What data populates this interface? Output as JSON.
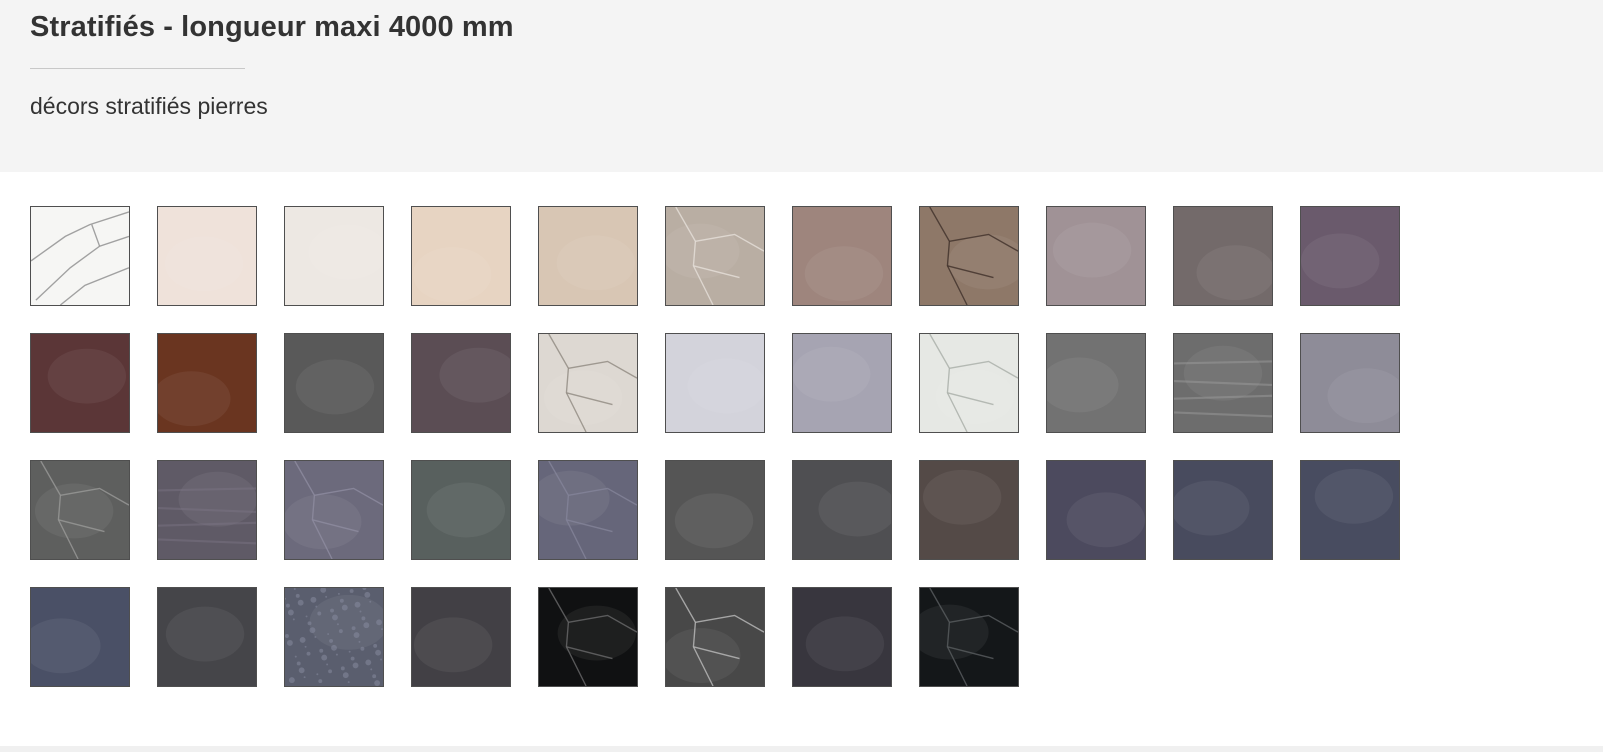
{
  "header": {
    "title": "Stratifiés - longueur maxi 4000 mm",
    "subtitle": "décors stratifiés pierres"
  },
  "swatches": [
    {
      "color": "#f6f6f4",
      "veins": "marble-light",
      "vein_color": "#8c8c8c"
    },
    {
      "color": "#efe2da",
      "veins": "",
      "vein_color": ""
    },
    {
      "color": "#ede8e3",
      "veins": "",
      "vein_color": ""
    },
    {
      "color": "#e7d4c2",
      "veins": "",
      "vein_color": ""
    },
    {
      "color": "#d8c6b4",
      "veins": "",
      "vein_color": ""
    },
    {
      "color": "#b9aea3",
      "veins": "crack",
      "vein_color": "#e6e0da"
    },
    {
      "color": "#9e857d",
      "veins": "",
      "vein_color": ""
    },
    {
      "color": "#8e7868",
      "veins": "crack",
      "vein_color": "#3e3029"
    },
    {
      "color": "#a09296",
      "veins": "",
      "vein_color": ""
    },
    {
      "color": "#736a6a",
      "veins": "",
      "vein_color": ""
    },
    {
      "color": "#6a5a6c",
      "veins": "",
      "vein_color": ""
    },
    {
      "color": "#5b3637",
      "veins": "",
      "vein_color": ""
    },
    {
      "color": "#6a3520",
      "veins": "",
      "vein_color": ""
    },
    {
      "color": "#595959",
      "veins": "",
      "vein_color": ""
    },
    {
      "color": "#5b4d54",
      "veins": "",
      "vein_color": ""
    },
    {
      "color": "#ddd8d2",
      "veins": "crack",
      "vein_color": "#8f8880"
    },
    {
      "color": "#d3d3db",
      "veins": "",
      "vein_color": ""
    },
    {
      "color": "#a6a4b2",
      "veins": "",
      "vein_color": ""
    },
    {
      "color": "#e6e8e4",
      "veins": "crack",
      "vein_color": "#a8aca6"
    },
    {
      "color": "#727272",
      "veins": "",
      "vein_color": ""
    },
    {
      "color": "#6d6d6d",
      "veins": "stripes",
      "vein_color": "#a0a0a0"
    },
    {
      "color": "#8e8c98",
      "veins": "",
      "vein_color": ""
    },
    {
      "color": "#5e5f5e",
      "veins": "crack",
      "vein_color": "#9a9a98"
    },
    {
      "color": "#5f5a66",
      "veins": "stripes",
      "vein_color": "#7c7684"
    },
    {
      "color": "#6c6a7c",
      "veins": "crack",
      "vein_color": "#8e8ca0"
    },
    {
      "color": "#58605e",
      "veins": "",
      "vein_color": ""
    },
    {
      "color": "#66667a",
      "veins": "crack",
      "vein_color": "#84849a"
    },
    {
      "color": "#555555",
      "veins": "",
      "vein_color": ""
    },
    {
      "color": "#4f4f52",
      "veins": "",
      "vein_color": ""
    },
    {
      "color": "#544a47",
      "veins": "",
      "vein_color": ""
    },
    {
      "color": "#4c4a5e",
      "veins": "",
      "vein_color": ""
    },
    {
      "color": "#484b5e",
      "veins": "",
      "vein_color": ""
    },
    {
      "color": "#484c60",
      "veins": "",
      "vein_color": ""
    },
    {
      "color": "#4a5066",
      "veins": "",
      "vein_color": ""
    },
    {
      "color": "#454549",
      "veins": "",
      "vein_color": ""
    },
    {
      "color": "#5a5e6e",
      "veins": "granite",
      "vein_color": "#8a8ea2"
    },
    {
      "color": "#424045",
      "veins": "",
      "vein_color": ""
    },
    {
      "color": "#101112",
      "veins": "crack",
      "vein_color": "#6a6a6c"
    },
    {
      "color": "#484848",
      "veins": "crack",
      "vein_color": "#bdbdbd"
    },
    {
      "color": "#38363e",
      "veins": "",
      "vein_color": ""
    },
    {
      "color": "#141719",
      "veins": "crack",
      "vein_color": "#5a5e60"
    }
  ]
}
